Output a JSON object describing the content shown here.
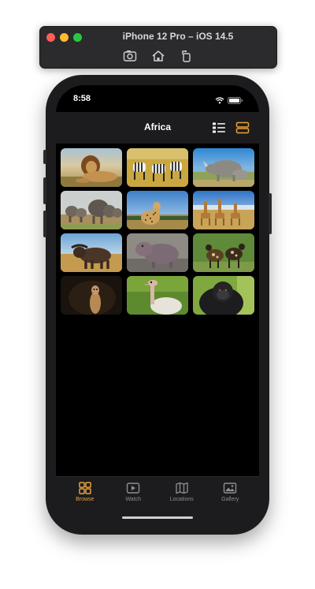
{
  "simulator": {
    "title": "iPhone 12 Pro – iOS 14.5",
    "icons": [
      "screenshot-icon",
      "home-icon",
      "rotate-icon"
    ]
  },
  "status": {
    "time": "8:58"
  },
  "nav": {
    "title": "Africa"
  },
  "colors": {
    "accent": "#e8a13a",
    "tab_inactive": "#8e8e93"
  },
  "grid": {
    "items": [
      "lion",
      "zebras",
      "rhinos",
      "elephants-herd",
      "cheetah",
      "giraffes",
      "buffalo",
      "hippo",
      "wild-dogs",
      "meerkat",
      "ostrich",
      "gorilla"
    ]
  },
  "tabs": [
    {
      "label": "Browse",
      "active": true,
      "icon": "grid-icon"
    },
    {
      "label": "Watch",
      "active": false,
      "icon": "play-icon"
    },
    {
      "label": "Locations",
      "active": false,
      "icon": "map-icon"
    },
    {
      "label": "Gallery",
      "active": false,
      "icon": "photo-icon"
    }
  ]
}
